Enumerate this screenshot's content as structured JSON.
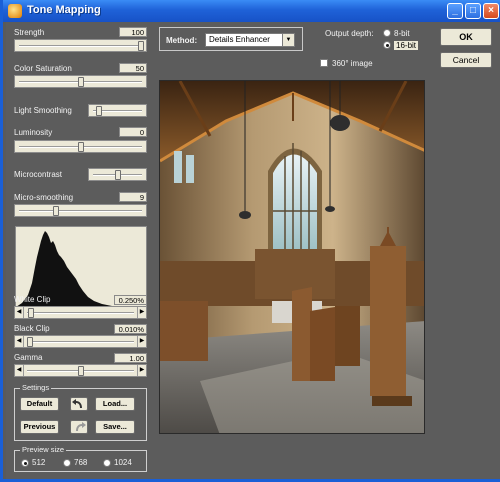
{
  "window": {
    "title": "Tone Mapping"
  },
  "controls": {
    "strength": {
      "label": "Strength",
      "value": "100",
      "fraction": 1.0
    },
    "color_saturation": {
      "label": "Color Saturation",
      "value": "50",
      "fraction": 0.5
    },
    "light_smoothing": {
      "label": "Light Smoothing",
      "fraction": 0.1
    },
    "luminosity": {
      "label": "Luminosity",
      "value": "0",
      "fraction": 0.5
    },
    "microcontrast": {
      "label": "Microcontrast",
      "fraction": 0.5
    },
    "micro_smoothing": {
      "label": "Micro-smoothing",
      "value": "9",
      "fraction": 0.3
    },
    "white_clip": {
      "label": "White Clip",
      "value": "0.250%",
      "fraction": 0.02
    },
    "black_clip": {
      "label": "Black Clip",
      "value": "0.010%",
      "fraction": 0.01
    },
    "gamma": {
      "label": "Gamma",
      "value": "1.00",
      "fraction": 0.5
    }
  },
  "settings": {
    "legend": "Settings",
    "default_label": "Default",
    "load_label": "Load...",
    "previous_label": "Previous",
    "save_label": "Save..."
  },
  "preview_size": {
    "legend": "Preview size",
    "options": [
      "512",
      "768",
      "1024"
    ],
    "selected": "512"
  },
  "method": {
    "label": "Method:",
    "value": "Details Enhancer"
  },
  "output_depth": {
    "label": "Output depth:",
    "options": [
      "8-bit",
      "16-bit"
    ],
    "selected": "16-bit"
  },
  "image_360": {
    "label": "360° image",
    "checked": false
  },
  "buttons": {
    "ok_label": "OK",
    "cancel_label": "Cancel"
  },
  "colors": {
    "titlebar": "#1f62d8",
    "panel": "#5c5c5c",
    "control": "#ece9d8"
  }
}
